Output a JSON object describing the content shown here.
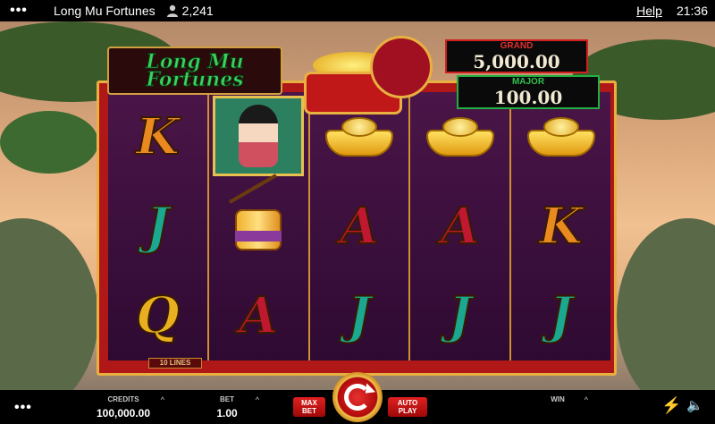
{
  "topbar": {
    "menu_icon": "dots-icon",
    "title": "Long Mu Fortunes",
    "players_icon": "user-icon",
    "players": "2,241",
    "help": "Help",
    "clock": "21:36"
  },
  "game": {
    "logo_line1": "Long Mu",
    "logo_line2": "Fortunes",
    "jackpots": {
      "grand_label": "GRAND",
      "grand_value": "5,000.00",
      "major_label": "MAJOR",
      "major_value": "100.00"
    },
    "lines_tag": "10 LINES",
    "reels": [
      [
        "K",
        "J",
        "Q"
      ],
      [
        "lady",
        "drum",
        "A"
      ],
      [
        "ingot",
        "A",
        "J"
      ],
      [
        "ingot",
        "A",
        "J"
      ],
      [
        "ingot",
        "K",
        "J"
      ]
    ]
  },
  "bottombar": {
    "menu_icon": "dots-icon",
    "credits_label": "CREDITS",
    "credits_value": "100,000.00",
    "bet_label": "BET",
    "bet_value": "1.00",
    "max_bet_line1": "MAX",
    "max_bet_line2": "BET",
    "auto_play_line1": "AUTO",
    "auto_play_line2": "PLAY",
    "win_label": "WIN",
    "spin_icon": "spin-icon",
    "turbo_icon": "lightning-icon",
    "sound_icon": "speaker-icon"
  }
}
